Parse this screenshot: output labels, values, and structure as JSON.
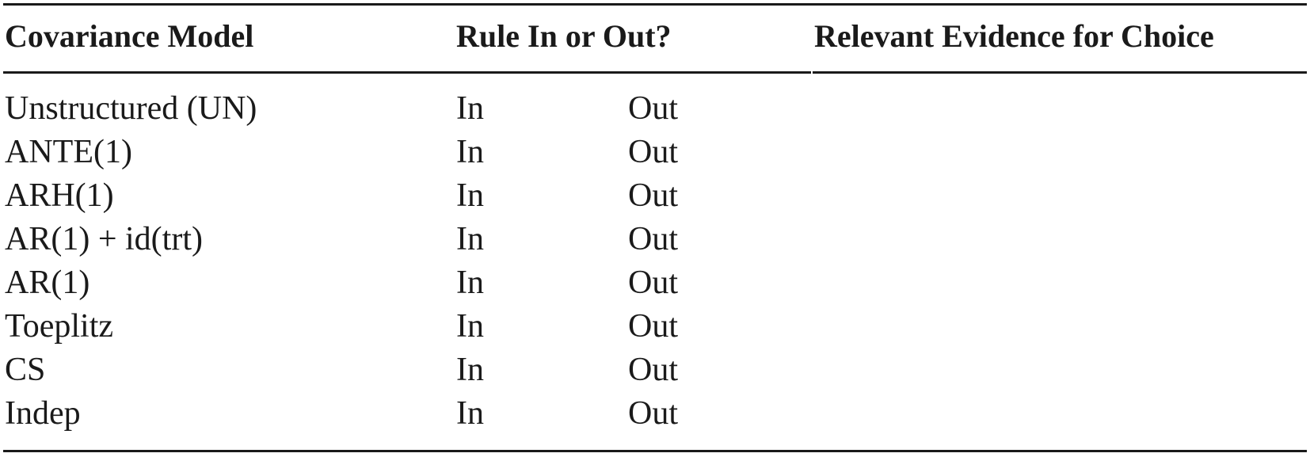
{
  "table": {
    "headers": {
      "model": "Covariance Model",
      "rule": "Rule In or Out?",
      "evidence": "Relevant Evidence for Choice"
    },
    "rows": [
      {
        "model": "Unstructured (UN)",
        "in": "In",
        "out": "Out",
        "evidence": ""
      },
      {
        "model": "ANTE(1)",
        "in": "In",
        "out": "Out",
        "evidence": ""
      },
      {
        "model": "ARH(1)",
        "in": "In",
        "out": "Out",
        "evidence": ""
      },
      {
        "model": "AR(1) + id(trt)",
        "in": "In",
        "out": "Out",
        "evidence": ""
      },
      {
        "model": "AR(1)",
        "in": "In",
        "out": "Out",
        "evidence": ""
      },
      {
        "model": "Toeplitz",
        "in": "In",
        "out": "Out",
        "evidence": ""
      },
      {
        "model": "CS",
        "in": "In",
        "out": "Out",
        "evidence": ""
      },
      {
        "model": "Indep",
        "in": "In",
        "out": "Out",
        "evidence": ""
      }
    ]
  }
}
